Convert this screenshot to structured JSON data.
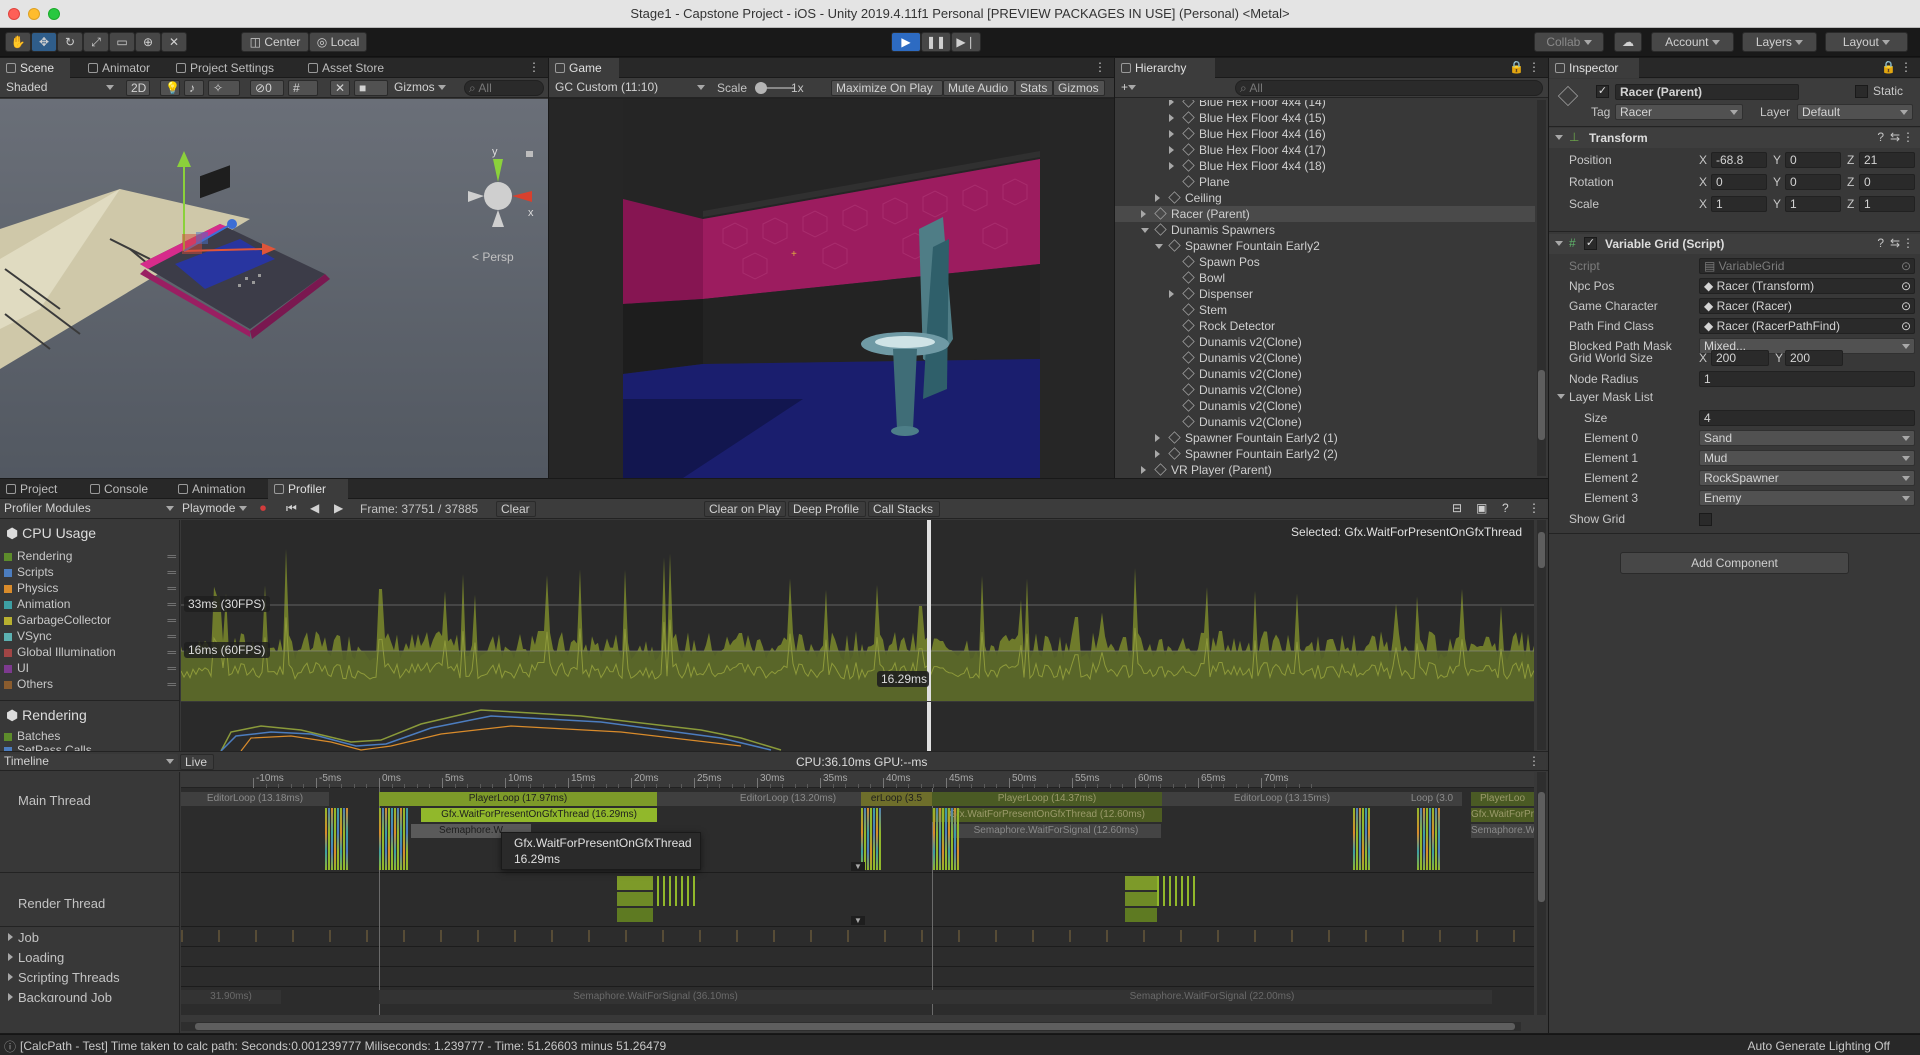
{
  "window": {
    "title": "Stage1 - Capstone Project - iOS - Unity 2019.4.11f1 Personal [PREVIEW PACKAGES IN USE] (Personal) <Metal>"
  },
  "toolbar": {
    "center": "Center",
    "local": "Local",
    "collab": "Collab",
    "account": "Account",
    "layers": "Layers",
    "layout": "Layout"
  },
  "scene": {
    "tabs": [
      "Scene",
      "Animator",
      "Project Settings",
      "Asset Store"
    ],
    "shading": "Shaded",
    "mode2d": "2D",
    "hidden_count": "0",
    "gizmos": "Gizmos",
    "search_placeholder": "All",
    "persp_label": "Persp",
    "axis_y": "y",
    "axis_x": "x"
  },
  "game": {
    "tab": "Game",
    "aspect": "GC Custom (11:10)",
    "scale_label": "Scale",
    "scale_value": "1x",
    "maximize": "Maximize On Play",
    "mute": "Mute Audio",
    "stats": "Stats",
    "gizmos": "Gizmos"
  },
  "hierarchy": {
    "tab": "Hierarchy",
    "add": "+",
    "search_placeholder": "All",
    "items": [
      {
        "label": "Blue Hex Floor 4x4 (14)",
        "indent": 4,
        "expander": true
      },
      {
        "label": "Blue Hex Floor 4x4 (15)",
        "indent": 4,
        "expander": true
      },
      {
        "label": "Blue Hex Floor 4x4 (16)",
        "indent": 4,
        "expander": true
      },
      {
        "label": "Blue Hex Floor 4x4 (17)",
        "indent": 4,
        "expander": true
      },
      {
        "label": "Blue Hex Floor 4x4 (18)",
        "indent": 4,
        "expander": true
      },
      {
        "label": "Plane",
        "indent": 4,
        "expander": false
      },
      {
        "label": "Ceiling",
        "indent": 3,
        "expander": true
      },
      {
        "label": "Racer (Parent)",
        "indent": 2,
        "expander": true,
        "selected": true
      },
      {
        "label": "Dunamis Spawners",
        "indent": 2,
        "expander": true,
        "open": true
      },
      {
        "label": "Spawner Fountain Early2",
        "indent": 3,
        "expander": true,
        "open": true
      },
      {
        "label": "Spawn Pos",
        "indent": 4,
        "expander": false
      },
      {
        "label": "Bowl",
        "indent": 4,
        "expander": false
      },
      {
        "label": "Dispenser",
        "indent": 4,
        "expander": true
      },
      {
        "label": "Stem",
        "indent": 4,
        "expander": false
      },
      {
        "label": "Rock Detector",
        "indent": 4,
        "expander": false
      },
      {
        "label": "Dunamis v2(Clone)",
        "indent": 4,
        "expander": false
      },
      {
        "label": "Dunamis v2(Clone)",
        "indent": 4,
        "expander": false
      },
      {
        "label": "Dunamis v2(Clone)",
        "indent": 4,
        "expander": false
      },
      {
        "label": "Dunamis v2(Clone)",
        "indent": 4,
        "expander": false
      },
      {
        "label": "Dunamis v2(Clone)",
        "indent": 4,
        "expander": false
      },
      {
        "label": "Dunamis v2(Clone)",
        "indent": 4,
        "expander": false
      },
      {
        "label": "Spawner Fountain Early2 (1)",
        "indent": 3,
        "expander": true
      },
      {
        "label": "Spawner Fountain Early2 (2)",
        "indent": 3,
        "expander": true
      },
      {
        "label": "VR Player (Parent)",
        "indent": 2,
        "expander": true
      }
    ]
  },
  "inspector": {
    "tab": "Inspector",
    "object_name": "Racer (Parent)",
    "static_label": "Static",
    "tag_label": "Tag",
    "tag_value": "Racer",
    "layer_label": "Layer",
    "layer_value": "Default",
    "transform": {
      "title": "Transform",
      "position_label": "Position",
      "rotation_label": "Rotation",
      "scale_label": "Scale",
      "position": [
        "-68.8",
        "0",
        "21"
      ],
      "rotation": [
        "0",
        "0",
        "0"
      ],
      "scale": [
        "1",
        "1",
        "1"
      ],
      "axes": [
        "X",
        "Y",
        "Z"
      ]
    },
    "script_component": {
      "title": "Variable Grid (Script)",
      "fields": [
        {
          "label": "Script",
          "value": "VariableGrid",
          "disabled": true
        },
        {
          "label": "Npc Pos",
          "value": "Racer (Transform)"
        },
        {
          "label": "Game Character",
          "value": "Racer (Racer)"
        },
        {
          "label": "Path Find Class",
          "value": "Racer (RacerPathFind)"
        },
        {
          "label": "Blocked Path Mask",
          "value": "Mixed..."
        }
      ],
      "grid_world_size_label": "Grid World Size",
      "grid_x": "200",
      "grid_y": "200",
      "node_radius_label": "Node Radius",
      "node_radius": "1",
      "layer_mask_list_label": "Layer Mask List",
      "size_label": "Size",
      "size": "4",
      "elements": [
        {
          "label": "Element 0",
          "value": "Sand"
        },
        {
          "label": "Element 1",
          "value": "Mud"
        },
        {
          "label": "Element 2",
          "value": "RockSpawner"
        },
        {
          "label": "Element 3",
          "value": "Enemy"
        }
      ],
      "show_grid_label": "Show Grid"
    },
    "add_component": "Add Component"
  },
  "bottom": {
    "tabs": [
      "Project",
      "Console",
      "Animation",
      "Profiler"
    ]
  },
  "profiler": {
    "modules_label": "Profiler Modules",
    "playmode": "Playmode",
    "frame": "Frame: 37751 / 37885",
    "clear": "Clear",
    "clear_on_play": "Clear on Play",
    "deep_profile": "Deep Profile",
    "call_stacks": "Call Stacks",
    "cpu_usage": "CPU Usage",
    "legend": [
      {
        "label": "Rendering",
        "color": "#5d8c2b"
      },
      {
        "label": "Scripts",
        "color": "#4c7dbf"
      },
      {
        "label": "Physics",
        "color": "#d98b2b"
      },
      {
        "label": "Animation",
        "color": "#3d9fa3"
      },
      {
        "label": "GarbageCollector",
        "color": "#b8b030"
      },
      {
        "label": "VSync",
        "color": "#5cb0b0"
      },
      {
        "label": "Global Illumination",
        "color": "#a04545"
      },
      {
        "label": "UI",
        "color": "#7d3a8f"
      },
      {
        "label": "Others",
        "color": "#8a5c2e"
      }
    ],
    "rendering_label": "Rendering",
    "batches_label": "Batches",
    "setpass_label": "SetPass Calls",
    "fps30": "33ms (30FPS)",
    "fps60": "16ms (60FPS)",
    "selected_value": "16.29ms",
    "selected_label": "Selected: Gfx.WaitForPresentOnGfxThread",
    "timeline_label": "Timeline",
    "live": "Live",
    "cpu_gpu": "CPU:36.10ms   GPU:--ms",
    "ruler": [
      "-10ms",
      "-5ms",
      "0ms",
      "5ms",
      "10ms",
      "15ms",
      "20ms",
      "25ms",
      "30ms",
      "35ms",
      "40ms",
      "45ms",
      "50ms",
      "55ms",
      "60ms",
      "65ms",
      "70ms"
    ],
    "threads": [
      "Main Thread",
      "Render Thread",
      "Job",
      "Loading",
      "Scripting Threads",
      "Background Job"
    ],
    "bars": {
      "editor_loop_a": "EditorLoop (13.18ms)",
      "player_loop_a": "PlayerLoop (17.97ms)",
      "gfx_a": "Gfx.WaitForPresentOnGfxThread (16.29ms)",
      "semaphore_a": "Semaphore.W",
      "editor_loop_b": "EditorLoop (13.20ms)",
      "loop_b": "erLoop (3.5",
      "player_loop_b": "PlayerLoop (14.37ms)",
      "gfx_b": "Gfx.WaitForPresentOnGfxThread (12.60ms)",
      "semaphore_b": "Semaphore.WaitForSignal (12.60ms)",
      "editor_loop_c": "EditorLoop (13.15ms)",
      "loop_c": "Loop (3.0",
      "player_loop_c": "PlayerLoo",
      "gfx_c": "Gfx.WaitForPres",
      "semaphore_c": "Semaphore.W",
      "sem_signal_a": "Semaphore.WaitForSignal (36.10ms)",
      "sem_signal_b": "Semaphore.WaitForSignal (22.00ms)",
      "left_ms": "31.90ms)"
    },
    "tooltip_title": "Gfx.WaitForPresentOnGfxThread",
    "tooltip_value": "16.29ms"
  },
  "status": {
    "message": "[CalcPath - Test] Time taken to calc path: Seconds:0.001239777  Miliseconds: 1.239777 - Time: 51.26603 minus 51.26479",
    "lighting": "Auto Generate Lighting Off"
  }
}
